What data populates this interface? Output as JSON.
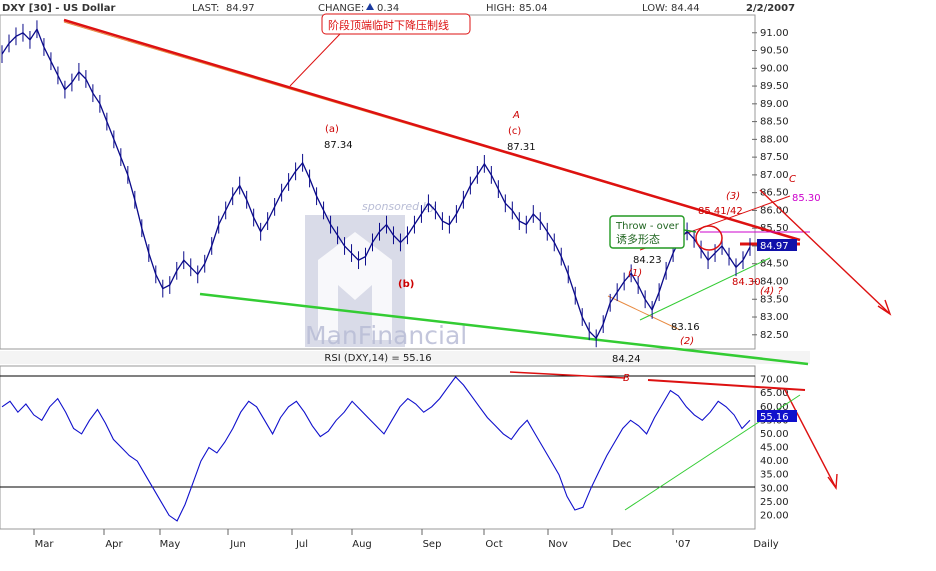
{
  "header": {
    "symbol": "DXY [30] - US Dollar",
    "last_label": "LAST:",
    "last_value": "84.97",
    "change_label": "CHANGE:",
    "change_value": "0.34",
    "high_label": "HIGH:",
    "high_value": "85.04",
    "low_label": "LOW:",
    "low_value": "84.44",
    "date": "2/2/2007"
  },
  "watermark": {
    "sponsored": "sponsored by",
    "brand": "ManFinancial"
  },
  "chart_data": [
    {
      "type": "line",
      "title": "DXY [30] - US Dollar",
      "x_tick_labels": [
        "Mar",
        "Apr",
        "May",
        "Jun",
        "Jul",
        "Aug",
        "Sep",
        "Oct",
        "Nov",
        "Dec",
        "'07",
        "Daily"
      ],
      "y_tick_labels": [
        "82.50",
        "83.00",
        "83.50",
        "84.00",
        "84.50",
        "85.00",
        "85.50",
        "86.00",
        "86.50",
        "87.00",
        "87.50",
        "88.00",
        "88.50",
        "89.00",
        "89.50",
        "90.00",
        "90.50",
        "91.00"
      ],
      "ylim": [
        82.1,
        91.5
      ],
      "series": [
        {
          "values": [
            90.4,
            90.7,
            90.9,
            91.0,
            90.8,
            91.1,
            90.6,
            90.2,
            89.8,
            89.4,
            89.6,
            89.9,
            89.7,
            89.3,
            89.0,
            88.5,
            88.0,
            87.5,
            87.0,
            86.3,
            85.5,
            84.8,
            84.2,
            83.8,
            83.9,
            84.3,
            84.6,
            84.4,
            84.2,
            84.5,
            85.0,
            85.6,
            86.0,
            86.4,
            86.7,
            86.3,
            85.8,
            85.4,
            85.7,
            86.1,
            86.5,
            86.8,
            87.1,
            87.34,
            86.9,
            86.4,
            86.0,
            85.6,
            85.3,
            85.0,
            84.8,
            84.6,
            84.7,
            85.1,
            85.4,
            85.6,
            85.3,
            85.1,
            85.3,
            85.6,
            85.9,
            86.2,
            86.0,
            85.7,
            85.6,
            85.9,
            86.3,
            86.7,
            87.0,
            87.31,
            87.0,
            86.6,
            86.2,
            86.0,
            85.7,
            85.6,
            85.9,
            85.7,
            85.4,
            85.1,
            84.7,
            84.2,
            83.6,
            83.0,
            82.6,
            82.4,
            82.8,
            83.4,
            83.7,
            84.0,
            84.23,
            83.9,
            83.5,
            83.2,
            83.7,
            84.3,
            84.8,
            85.2,
            85.41,
            85.2,
            84.9,
            84.6,
            84.8,
            85.0,
            84.7,
            84.4,
            84.6,
            84.97
          ]
        }
      ]
    },
    {
      "type": "line",
      "title": "RSI (DXY,14) = 55.16",
      "x_tick_labels": [
        "Mar",
        "Apr",
        "May",
        "Jun",
        "Jul",
        "Aug",
        "Sep",
        "Oct",
        "Nov",
        "Dec",
        "'07",
        "Daily"
      ],
      "y_tick_labels": [
        "20.00",
        "25.00",
        "30.00",
        "35.00",
        "40.00",
        "45.00",
        "50.00",
        "55.00",
        "60.00",
        "65.00",
        "70.00"
      ],
      "ylim": [
        15,
        75
      ],
      "series": [
        {
          "values": [
            60,
            62,
            58,
            61,
            57,
            55,
            60,
            63,
            58,
            52,
            50,
            55,
            59,
            54,
            48,
            45,
            42,
            40,
            35,
            30,
            25,
            20,
            18,
            24,
            32,
            40,
            45,
            43,
            47,
            52,
            58,
            62,
            60,
            55,
            50,
            56,
            60,
            62,
            58,
            53,
            49,
            51,
            55,
            58,
            62,
            59,
            56,
            53,
            50,
            55,
            60,
            63,
            61,
            58,
            60,
            63,
            67,
            71,
            68,
            64,
            60,
            56,
            53,
            50,
            48,
            52,
            55,
            50,
            45,
            40,
            35,
            27,
            22,
            23,
            30,
            36,
            42,
            47,
            52,
            55,
            53,
            50,
            56,
            61,
            66,
            64,
            60,
            57,
            55,
            58,
            62,
            60,
            57,
            52,
            55
          ]
        }
      ]
    }
  ],
  "annotations": {
    "cn_top": "阶段顶端临时下降压制线",
    "wave_a_small": "(a)",
    "wave_a_small_value": "87.34",
    "wave_A": "A",
    "wave_c_small": "(c)",
    "wave_c_small_value": "87.31",
    "wave_b_small": "(b)",
    "wave_1": "(1)",
    "wave_1_value": "84.23",
    "wave_2": "(2)",
    "wave_2_value": "83.16",
    "low_value": "84.24",
    "wave_3": "(3)",
    "wave_3_value": "85.41/42",
    "wave_4": "(4) ?",
    "wave_4_value": "84.30",
    "wave_C": "C",
    "target_value": "85.30",
    "last_box": "84.97",
    "rsi_box": "55.16",
    "wave_B": "B",
    "throw_over_line1": "Throw - over",
    "throw_over_line2": "诱多形态"
  },
  "colors": {
    "price_line": "#0a0a8a",
    "rsi_line": "#1010cc",
    "red_line": "#dd1111",
    "green_line": "#33cc33",
    "orange_line": "#e88a40",
    "magenta": "#cc00cc",
    "watermark": "#b9bdd6"
  }
}
